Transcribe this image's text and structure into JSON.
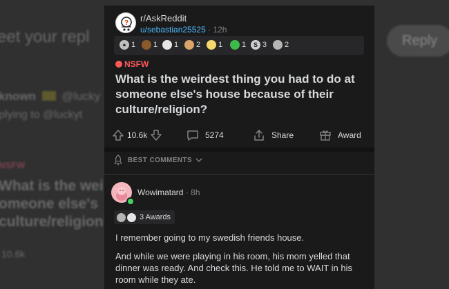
{
  "background": {
    "line1": "eet your repl",
    "reply_button": "Reply",
    "author_line": "known",
    "author_handle": "@lucky",
    "replying": "plying to @luckyt",
    "nsfw": "NSFW",
    "title_line1": "What is the wei",
    "title_line2": "omeone else's",
    "title_line3": "culture/religion?",
    "score": "10.6k"
  },
  "post": {
    "subreddit": "r/AskReddit",
    "author": "u/sebastian25525",
    "separator": "·",
    "age": "12h",
    "awards": [
      {
        "icon": "silver-award-icon",
        "count": "1",
        "color": "#c0c0c0"
      },
      {
        "icon": "poop-award-icon",
        "count": "1",
        "color": "#8a5a2b"
      },
      {
        "icon": "snoo-award-icon",
        "count": "1",
        "color": "#e6e6e6"
      },
      {
        "icon": "dog-award-icon",
        "count": "2",
        "color": "#d9a46a"
      },
      {
        "icon": "stars-award-icon",
        "count": "1",
        "color": "#f5d76e"
      },
      {
        "icon": "lizard-award-icon",
        "count": "1",
        "color": "#3dbb4a"
      },
      {
        "icon": "dollar-award-icon",
        "count": "3",
        "color": "#cfcfcf"
      },
      {
        "icon": "hands-award-icon",
        "count": "2",
        "color": "#b5b5b5"
      }
    ],
    "nsfw_label": "NSFW",
    "title": "What is the weirdest thing you had to do at someone else's house because of their culture/religion?",
    "score": "10.6k",
    "comments": "5274",
    "share_label": "Share",
    "award_label": "Award"
  },
  "comments_section": {
    "sort_label": "BEST COMMENTS"
  },
  "comment": {
    "author": "Wowimatard",
    "separator": "·",
    "age": "8h",
    "awards_label": "3 Awards",
    "paragraphs": [
      "I remember going to my swedish friends house.",
      "And while we were playing in his room, his mom yelled that dinner was ready. And check this. He told me to WAIT in his room while they ate."
    ]
  },
  "colors": {
    "accent_link": "#4fbcff",
    "nsfw": "#ff585b",
    "card_bg": "#1a1a1b",
    "text": "#d7dadc",
    "muted": "#818384",
    "online": "#46d160"
  }
}
